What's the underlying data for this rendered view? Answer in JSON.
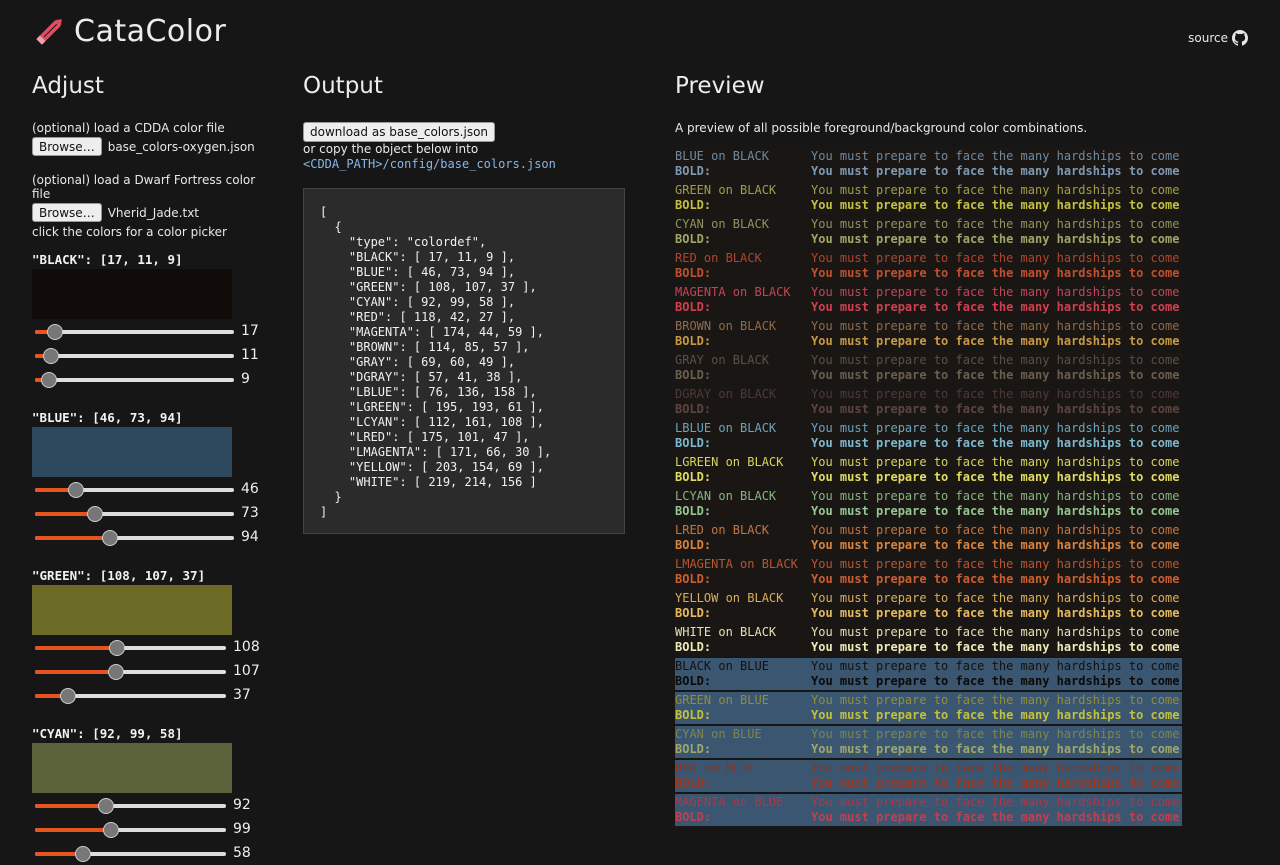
{
  "header": {
    "title": "CataColor",
    "source_label": "source"
  },
  "adjust": {
    "heading": "Adjust",
    "cdda_label": "(optional) load a CDDA color file",
    "cdda_browse": "Browse…",
    "cdda_file": "base_colors-oxygen.json",
    "df_label": "(optional) load a Dwarf Fortress color file",
    "df_browse": "Browse…",
    "df_file": "Vherid_Jade.txt",
    "picker_hint": "click the colors for a color picker",
    "colors": [
      {
        "title": "\"BLACK\": [17, 11, 9]",
        "rgb": [
          17,
          11,
          9
        ],
        "hex": "#110b09"
      },
      {
        "title": "\"BLUE\": [46, 73, 94]",
        "rgb": [
          46,
          73,
          94
        ],
        "hex": "#2e495e"
      },
      {
        "title": "\"GREEN\": [108, 107, 37]",
        "rgb": [
          108,
          107,
          37
        ],
        "hex": "#6c6b25"
      },
      {
        "title": "\"CYAN\": [92, 99, 58]",
        "rgb": [
          92,
          99,
          58
        ],
        "hex": "#5c633a"
      }
    ]
  },
  "output": {
    "heading": "Output",
    "download_label": "download as base_colors.json",
    "copy_text": "or copy the object below into",
    "config_path": "<CDDA_PATH>/config/base_colors.json",
    "json_text": "[\n  {\n    \"type\": \"colordef\",\n    \"BLACK\": [ 17, 11, 9 ],\n    \"BLUE\": [ 46, 73, 94 ],\n    \"GREEN\": [ 108, 107, 37 ],\n    \"CYAN\": [ 92, 99, 58 ],\n    \"RED\": [ 118, 42, 27 ],\n    \"MAGENTA\": [ 174, 44, 59 ],\n    \"BROWN\": [ 114, 85, 57 ],\n    \"GRAY\": [ 69, 60, 49 ],\n    \"DGRAY\": [ 57, 41, 38 ],\n    \"LBLUE\": [ 76, 136, 158 ],\n    \"LGREEN\": [ 195, 193, 61 ],\n    \"LCYAN\": [ 112, 161, 108 ],\n    \"LRED\": [ 175, 101, 47 ],\n    \"LMAGENTA\": [ 171, 66, 30 ],\n    \"YELLOW\": [ 203, 154, 69 ],\n    \"WHITE\": [ 219, 214, 156 ]\n  }\n]"
  },
  "preview": {
    "heading": "Preview",
    "description": "A preview of all possible foreground/background color combinations.",
    "sample_text": "You must prepare to face the many hardships to come",
    "bold_label": "BOLD:",
    "rows": [
      {
        "label": "BLUE on BLACK",
        "fg": "#6f8aa0",
        "bfg": "#7e9ab3",
        "bg": "#1a1614"
      },
      {
        "label": "GREEN on BLACK",
        "fg": "#a09e4a",
        "bfg": "#c3c13d",
        "bg": "#1a1614"
      },
      {
        "label": "CYAN on BLACK",
        "fg": "#8d9460",
        "bfg": "#a0a868",
        "bg": "#1a1614"
      },
      {
        "label": "RED on BLACK",
        "fg": "#b0452f",
        "bfg": "#c0502f",
        "bg": "#1a1614"
      },
      {
        "label": "MAGENTA on BLACK",
        "fg": "#c24556",
        "bfg": "#d0404f",
        "bg": "#1a1614"
      },
      {
        "label": "BROWN on BLACK",
        "fg": "#8e6c4a",
        "bfg": "#c79a45",
        "bg": "#1a1614"
      },
      {
        "label": "GRAY on BLACK",
        "fg": "#5a5044",
        "bfg": "#6a5e50",
        "bg": "#1a1614"
      },
      {
        "label": "DGRAY on BLACK",
        "fg": "#4d3a35",
        "bfg": "#5a463f",
        "bg": "#1a1614"
      },
      {
        "label": "LBLUE on BLACK",
        "fg": "#6aa5bd",
        "bfg": "#7cb8cf",
        "bg": "#1a1614"
      },
      {
        "label": "LGREEN on BLACK",
        "fg": "#d6d45a",
        "bfg": "#e0de60",
        "bg": "#1a1614"
      },
      {
        "label": "LCYAN on BLACK",
        "fg": "#86b681",
        "bfg": "#96c691",
        "bg": "#1a1614"
      },
      {
        "label": "LRED on BLACK",
        "fg": "#c27643",
        "bfg": "#d6843f",
        "bg": "#1a1614"
      },
      {
        "label": "LMAGENTA on BLACK",
        "fg": "#b75632",
        "bfg": "#cc5f30",
        "bg": "#1a1614"
      },
      {
        "label": "YELLOW on BLACK",
        "fg": "#dcae5a",
        "bfg": "#e6bb60",
        "bg": "#1a1614"
      },
      {
        "label": "WHITE on BLACK",
        "fg": "#e6e1b4",
        "bfg": "#efe9b8",
        "bg": "#1a1614"
      },
      {
        "label": "BLACK on BLUE",
        "fg": "#15100d",
        "bfg": "#0d0907",
        "bg": "#3a5670"
      },
      {
        "label": "GREEN on BLUE",
        "fg": "#8f8e3a",
        "bfg": "#c3c13d",
        "bg": "#3a5670"
      },
      {
        "label": "CYAN on BLUE",
        "fg": "#7d8650",
        "bfg": "#a0a868",
        "bg": "#3a5670"
      },
      {
        "label": "RED on BLUE",
        "fg": "#8e3424",
        "bfg": "#a3361f",
        "bg": "#3a5670"
      },
      {
        "label": "MAGENTA on BLUE",
        "fg": "#b0364a",
        "bfg": "#c0404f",
        "bg": "#3a5670"
      }
    ]
  }
}
